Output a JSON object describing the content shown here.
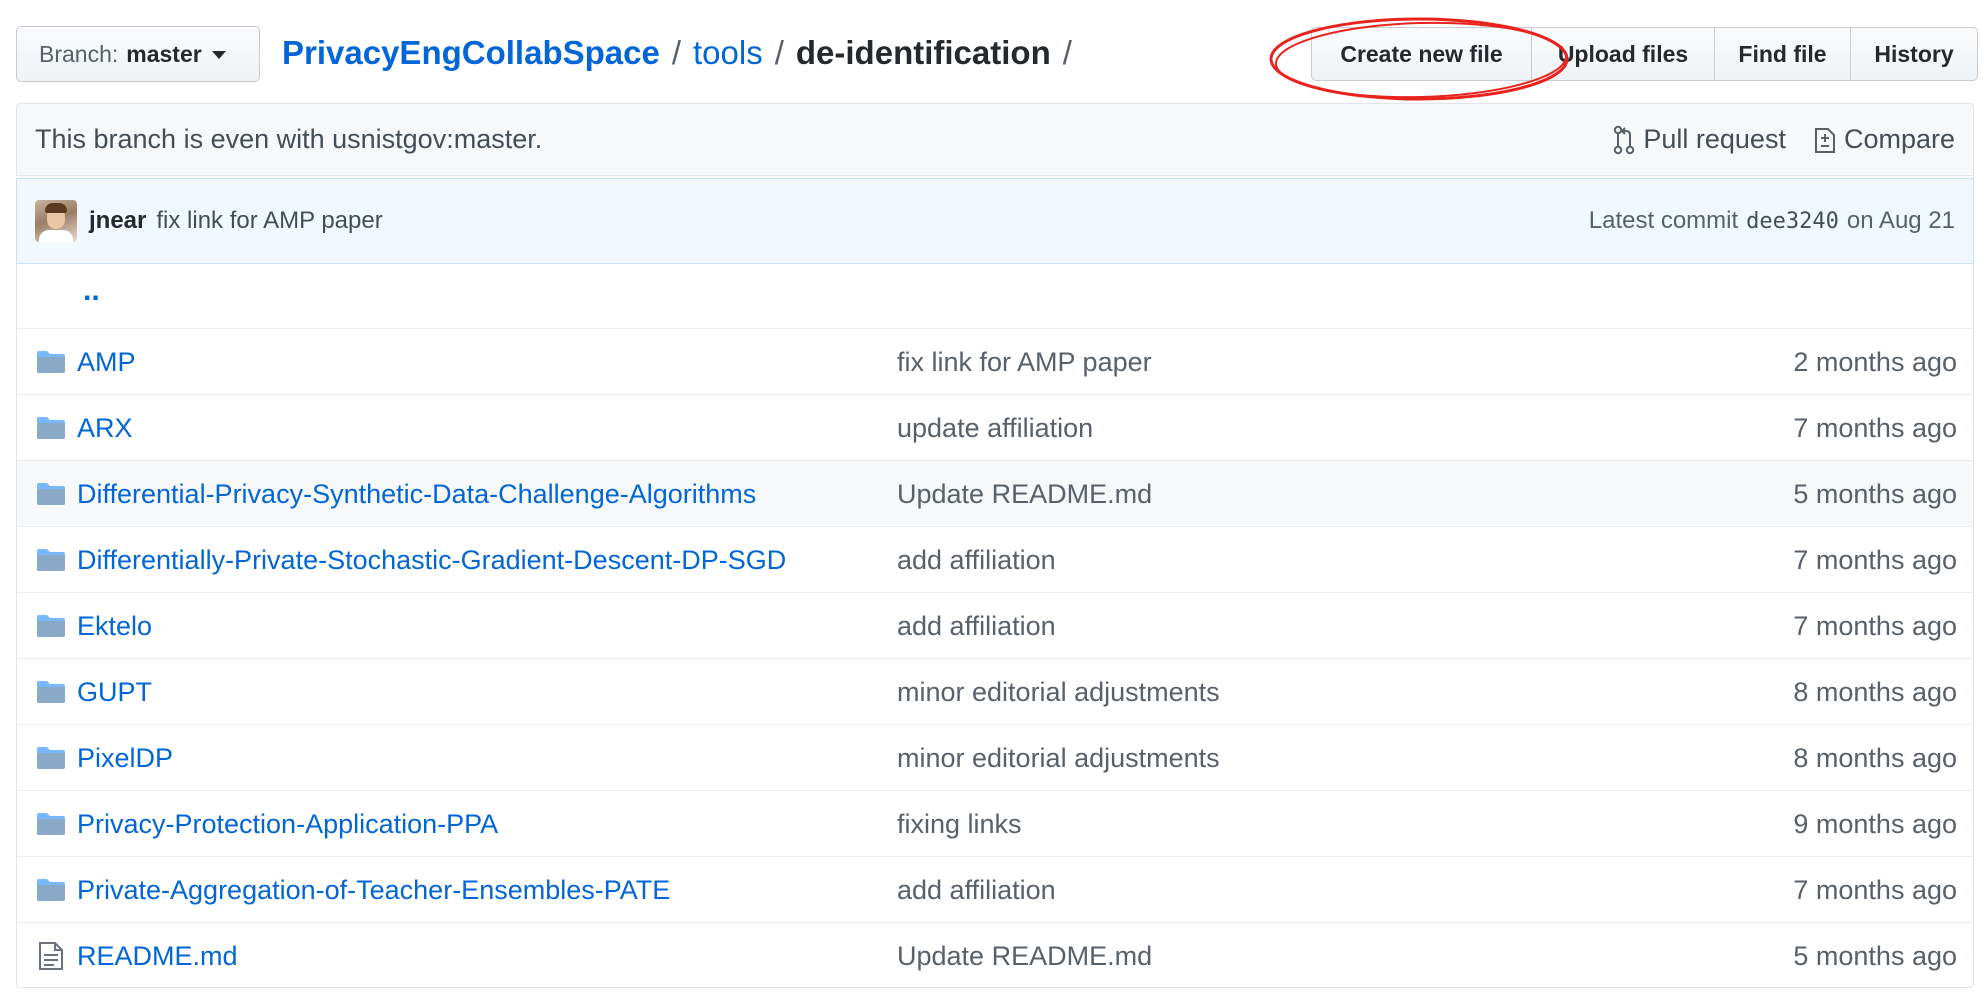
{
  "branch": {
    "label": "Branch:",
    "value": "master"
  },
  "breadcrumb": {
    "repo": "PrivacyEngCollabSpace",
    "sep": "/",
    "tools": "tools",
    "current": "de-identification"
  },
  "actions": {
    "create_new_file": "Create new file",
    "upload_files": "Upload files",
    "find_file": "Find file",
    "history": "History"
  },
  "compare_bar": {
    "message": "This branch is even with usnistgov:master.",
    "pull_request": "Pull request",
    "compare": "Compare"
  },
  "latest_commit": {
    "author": "jnear",
    "message": "fix link for AMP paper",
    "label": "Latest commit",
    "sha": "dee3240",
    "on": "on Aug 21"
  },
  "files": {
    "parent_link": "..",
    "rows": [
      {
        "type": "dir",
        "name": "AMP",
        "message": "fix link for AMP paper",
        "age": "2 months ago"
      },
      {
        "type": "dir",
        "name": "ARX",
        "message": "update affiliation",
        "age": "7 months ago"
      },
      {
        "type": "dir",
        "name": "Differential-Privacy-Synthetic-Data-Challenge-Algorithms",
        "message": "Update README.md",
        "age": "5 months ago"
      },
      {
        "type": "dir",
        "name": "Differentially-Private-Stochastic-Gradient-Descent-DP-SGD",
        "message": "add affiliation",
        "age": "7 months ago"
      },
      {
        "type": "dir",
        "name": "Ektelo",
        "message": "add affiliation",
        "age": "7 months ago"
      },
      {
        "type": "dir",
        "name": "GUPT",
        "message": "minor editorial adjustments",
        "age": "8 months ago"
      },
      {
        "type": "dir",
        "name": "PixelDP",
        "message": "minor editorial adjustments",
        "age": "8 months ago"
      },
      {
        "type": "dir",
        "name": "Privacy-Protection-Application-PPA",
        "message": "fixing links",
        "age": "9 months ago"
      },
      {
        "type": "dir",
        "name": "Private-Aggregation-of-Teacher-Ensembles-PATE",
        "message": "add affiliation",
        "age": "7 months ago"
      },
      {
        "type": "file",
        "name": "README.md",
        "message": "Update README.md",
        "age": "5 months ago"
      }
    ]
  },
  "colors": {
    "link": "#0366d6",
    "annotation": "#e8231d",
    "folder_icon": "#79b8ff",
    "commit_bar_bg": "#f1f8ff"
  }
}
